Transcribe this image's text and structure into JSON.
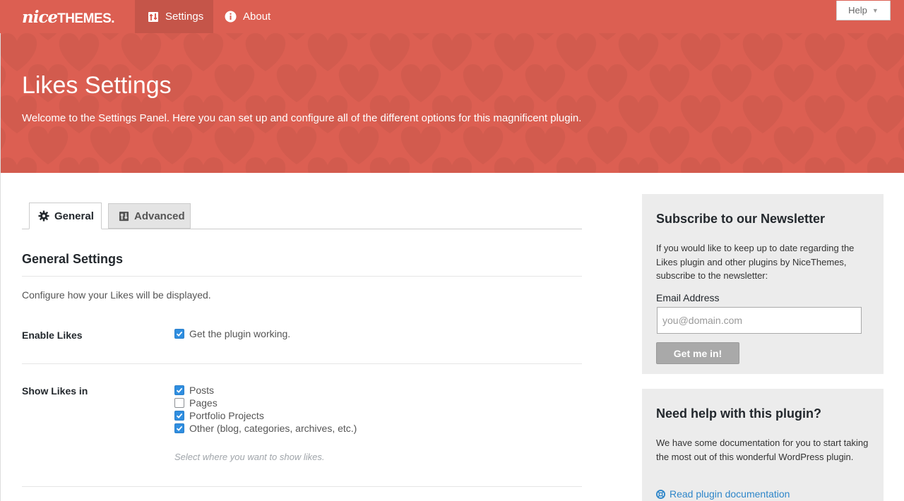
{
  "brand": {
    "logo_part1": "nice",
    "logo_part2": "THEMES."
  },
  "nav": {
    "items": [
      {
        "label": "Settings",
        "icon": "settings-sliders-icon",
        "active": true
      },
      {
        "label": "About",
        "icon": "info-circle-icon",
        "active": false
      }
    ],
    "help_label": "Help"
  },
  "hero": {
    "title": "Likes Settings",
    "description": "Welcome to the Settings Panel. Here you can set up and configure all of the different options for this magnificent plugin."
  },
  "tabs": [
    {
      "label": "General",
      "icon": "gear-icon",
      "active": true
    },
    {
      "label": "Advanced",
      "icon": "sliders-icon",
      "active": false
    }
  ],
  "general": {
    "title": "General Settings",
    "description": "Configure how your Likes will be displayed.",
    "enable_likes": {
      "label": "Enable Likes",
      "option": {
        "label": "Get the plugin working.",
        "checked": true
      }
    },
    "show_likes_in": {
      "label": "Show Likes in",
      "options": [
        {
          "label": "Posts",
          "checked": true
        },
        {
          "label": "Pages",
          "checked": false
        },
        {
          "label": "Portfolio Projects",
          "checked": true
        },
        {
          "label": "Other (blog, categories, archives, etc.)",
          "checked": true
        }
      ],
      "hint": "Select where you want to show likes."
    }
  },
  "newsletter": {
    "title": "Subscribe to our Newsletter",
    "text": "If you would like to keep up to date regarding the Likes plugin and other plugins by NiceThemes, subscribe to the newsletter:",
    "email_label": "Email Address",
    "email_placeholder": "you@domain.com",
    "email_value": "",
    "submit_label": "Get me in!"
  },
  "help_box": {
    "title": "Need help with this plugin?",
    "text": "We have some documentation for you to start taking the most out of this wonderful WordPress plugin.",
    "link_label": "Read plugin documentation"
  },
  "colors": {
    "brand": "#dc5f52",
    "checkbox_on": "#2f8ee0",
    "link": "#2e86c9",
    "sidebar_bg": "#ececec"
  }
}
